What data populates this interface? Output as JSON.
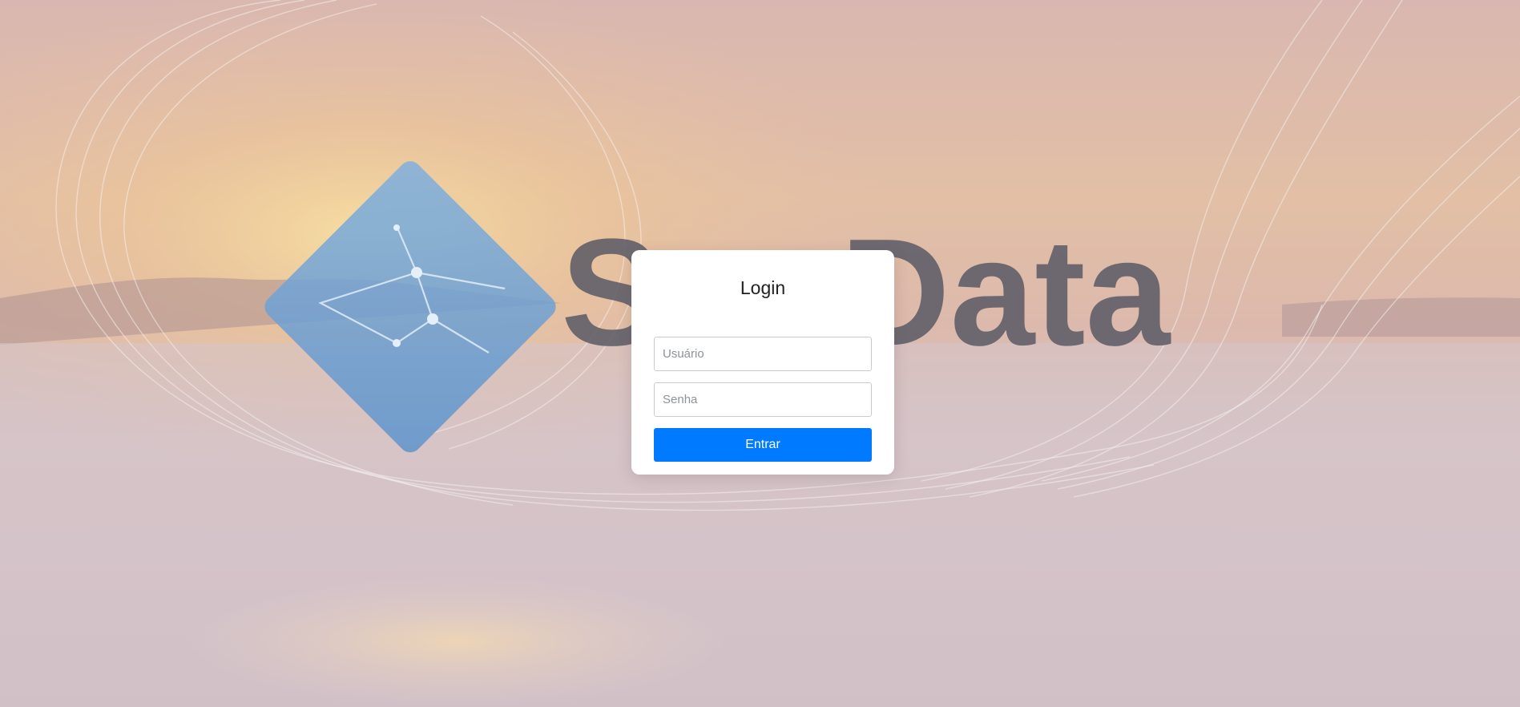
{
  "background": {
    "brand_wordmark": "SusData",
    "colors": {
      "sky_top": "#d6b8b5",
      "sun_glow": "#f2c890",
      "water": "#d8c6cc",
      "logo_blue": "#6d9fd3",
      "wordmark": "#5a5a66"
    }
  },
  "login": {
    "title": "Login",
    "username_placeholder": "Usuário",
    "password_placeholder": "Senha",
    "submit_label": "Entrar",
    "accent_color": "#007bff"
  }
}
